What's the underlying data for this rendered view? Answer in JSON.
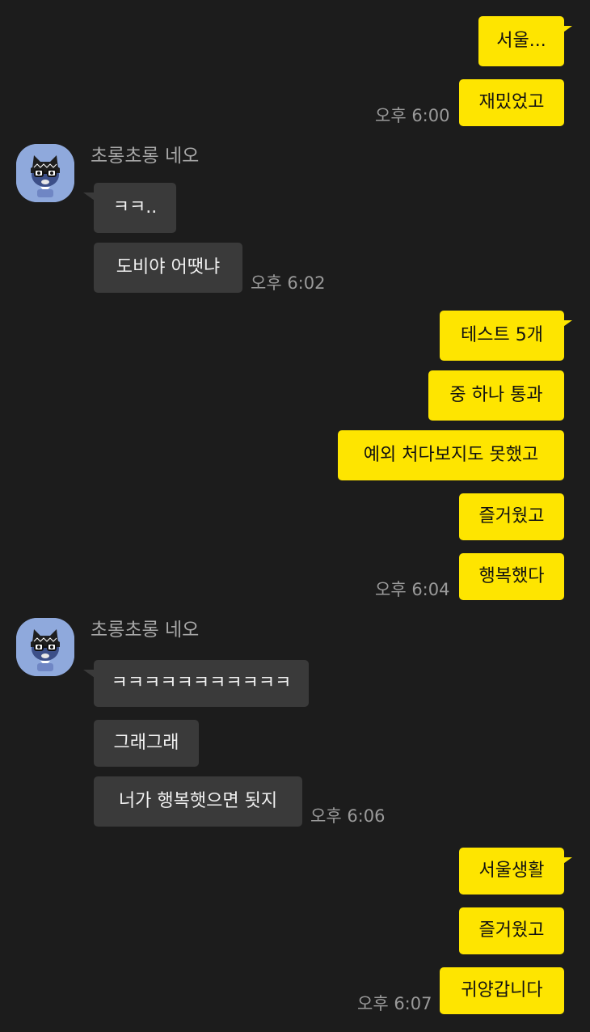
{
  "chat": {
    "sender_name": "초롱초롱 네오",
    "messages": {
      "m1": "서울...",
      "m2": "재밌었고",
      "t1": "오후 6:00",
      "o1": "ㅋㅋ..",
      "o2": "도비야 어땟냐",
      "t2": "오후 6:02",
      "m3": "테스트 5개",
      "m4": "중 하나 통과",
      "m5": "예외 처다보지도 못했고",
      "m6": "즐거웠고",
      "m7": "행복했다",
      "t3": "오후 6:04",
      "o3": "ㅋㅋㅋㅋㅋㅋㅋㅋㅋㅋㅋ",
      "o4": "그래그래",
      "o5": "너가 행복햇으면 됫지",
      "t4": "오후 6:06",
      "m8": "서울생활",
      "m9": "즐거웠고",
      "m10": "귀양갑니다",
      "t5": "오후 6:07"
    }
  },
  "colors": {
    "background": "#1c1c1c",
    "my_bubble": "#fee500",
    "other_bubble": "#3a3a3a",
    "timestamp": "#9a9a9a"
  },
  "icons": {
    "avatar": "neo-cat-avatar-icon"
  }
}
